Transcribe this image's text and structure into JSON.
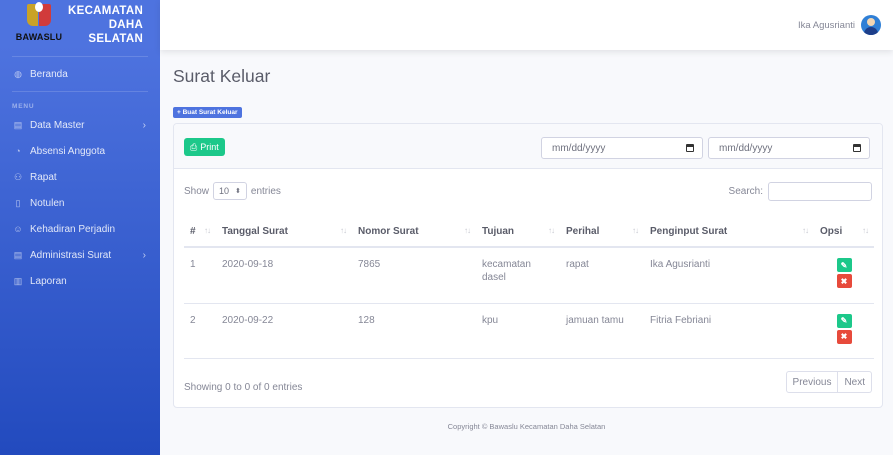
{
  "brand": {
    "logo_text": "BAWASLU",
    "line1": "KECAMATAN",
    "line2": "DAHA",
    "line3": "SELATAN"
  },
  "sidebar": {
    "items_top": [
      {
        "label": "Beranda",
        "icon": "dashboard-icon"
      }
    ],
    "heading": "MENU",
    "items": [
      {
        "label": "Data Master",
        "icon": "folder-icon",
        "has_chevron": true
      },
      {
        "label": "Absensi Anggota",
        "icon": "clock-icon"
      },
      {
        "label": "Rapat",
        "icon": "users-icon"
      },
      {
        "label": "Notulen",
        "icon": "file-icon"
      },
      {
        "label": "Kehadiran Perjadin",
        "icon": "user-check-icon"
      },
      {
        "label": "Administrasi Surat",
        "icon": "folder-icon",
        "has_chevron": true
      },
      {
        "label": "Laporan",
        "icon": "report-icon"
      }
    ],
    "chevron": "›"
  },
  "topbar": {
    "user_name": "Ika Agusrianti"
  },
  "page": {
    "title": "Surat Keluar",
    "new_button": "+ Buat Surat Keluar",
    "print_button": "Print",
    "date_from_placeholder": "mm/dd/yyyy",
    "date_to_placeholder": "mm/dd/yyyy"
  },
  "table_controls": {
    "show_label": "Show",
    "length_value": "10",
    "entries_label": "entries",
    "search_label": "Search:"
  },
  "table": {
    "columns": [
      "#",
      "Tanggal Surat",
      "Nomor Surat",
      "Tujuan",
      "Perihal",
      "Penginput Surat",
      "Opsi"
    ],
    "rows": [
      {
        "no": "1",
        "tanggal": "2020-09-18",
        "nomor": "7865",
        "tujuan": "kecamatan dasel",
        "perihal": "rapat",
        "penginput": "Ika Agusrianti"
      },
      {
        "no": "2",
        "tanggal": "2020-09-22",
        "nomor": "128",
        "tujuan": "kpu",
        "perihal": "jamuan tamu",
        "penginput": "Fitria Febriani"
      }
    ]
  },
  "footer_table": {
    "info": "Showing 0 to 0 of 0 entries",
    "previous": "Previous",
    "next": "Next"
  },
  "footer": {
    "copyright": "Copyright © Bawaslu Kecamatan Daha Selatan"
  },
  "colors": {
    "primary": "#4e73df",
    "success": "#1cc88a",
    "danger": "#e74a3b"
  }
}
